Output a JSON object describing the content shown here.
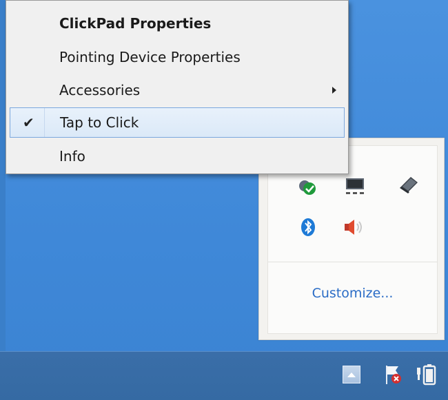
{
  "context_menu": {
    "items": [
      {
        "label": "ClickPad Properties",
        "bold": true,
        "checked": false,
        "has_submenu": false
      },
      {
        "label": "Pointing Device Properties",
        "bold": false,
        "checked": false,
        "has_submenu": false
      },
      {
        "label": "Accessories",
        "bold": false,
        "checked": false,
        "has_submenu": true
      },
      {
        "label": "Tap to Click",
        "bold": false,
        "checked": true,
        "has_submenu": false,
        "highlighted": true
      },
      {
        "label": "Info",
        "bold": false,
        "checked": false,
        "has_submenu": false
      }
    ],
    "check_glyph": "✔"
  },
  "tray_flyout": {
    "icons": [
      {
        "name": "security-shield-icon"
      },
      {
        "name": "network-icon"
      },
      {
        "name": "touchpad-icon"
      },
      {
        "name": "bluetooth-icon"
      },
      {
        "name": "speaker-icon"
      }
    ],
    "customize_label": "Customize..."
  },
  "taskbar": {
    "icons": [
      {
        "name": "show-hidden-icons-button"
      },
      {
        "name": "action-center-flag-icon"
      },
      {
        "name": "power-battery-icon"
      }
    ]
  },
  "colors": {
    "desktop": "#4a92df",
    "taskbar": "#3a6ea8",
    "link": "#2a6cc6",
    "highlight_border": "#7aa7dd"
  }
}
